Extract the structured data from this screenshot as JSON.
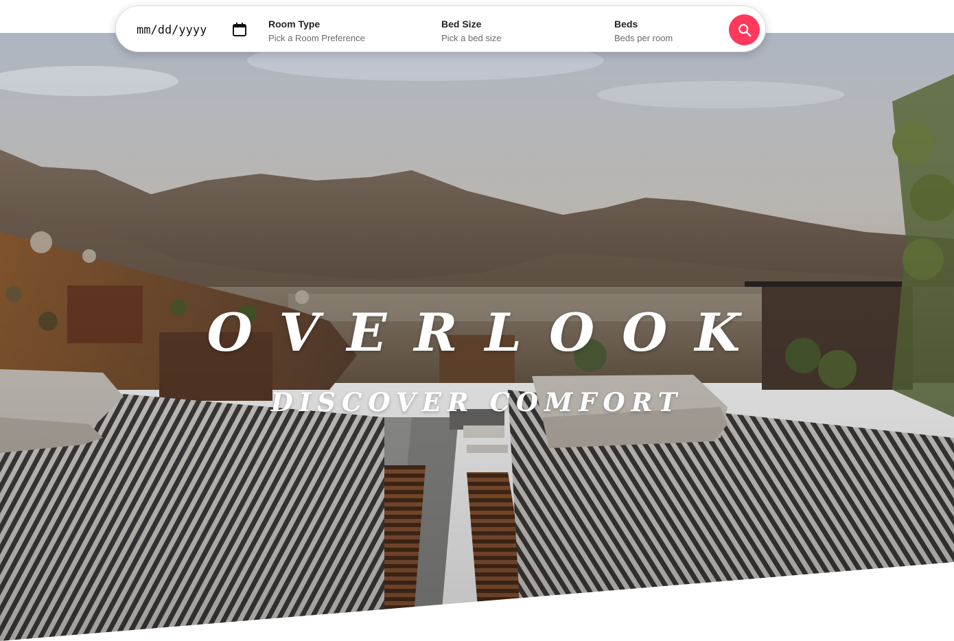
{
  "search": {
    "date_placeholder": "mm/dd/yyyy",
    "room_type": {
      "label": "Room Type",
      "hint": "Pick a Room Preference"
    },
    "bed_size": {
      "label": "Bed Size",
      "hint": "Pick a bed size"
    },
    "beds": {
      "label": "Beds",
      "hint": "Beds per room"
    },
    "calendar_icon": "calendar-icon",
    "search_icon": "search-icon",
    "accent_color": "#ff385c"
  },
  "hero": {
    "title": "OVERLOOK",
    "subtitle": "DISCOVER COMFORT"
  }
}
